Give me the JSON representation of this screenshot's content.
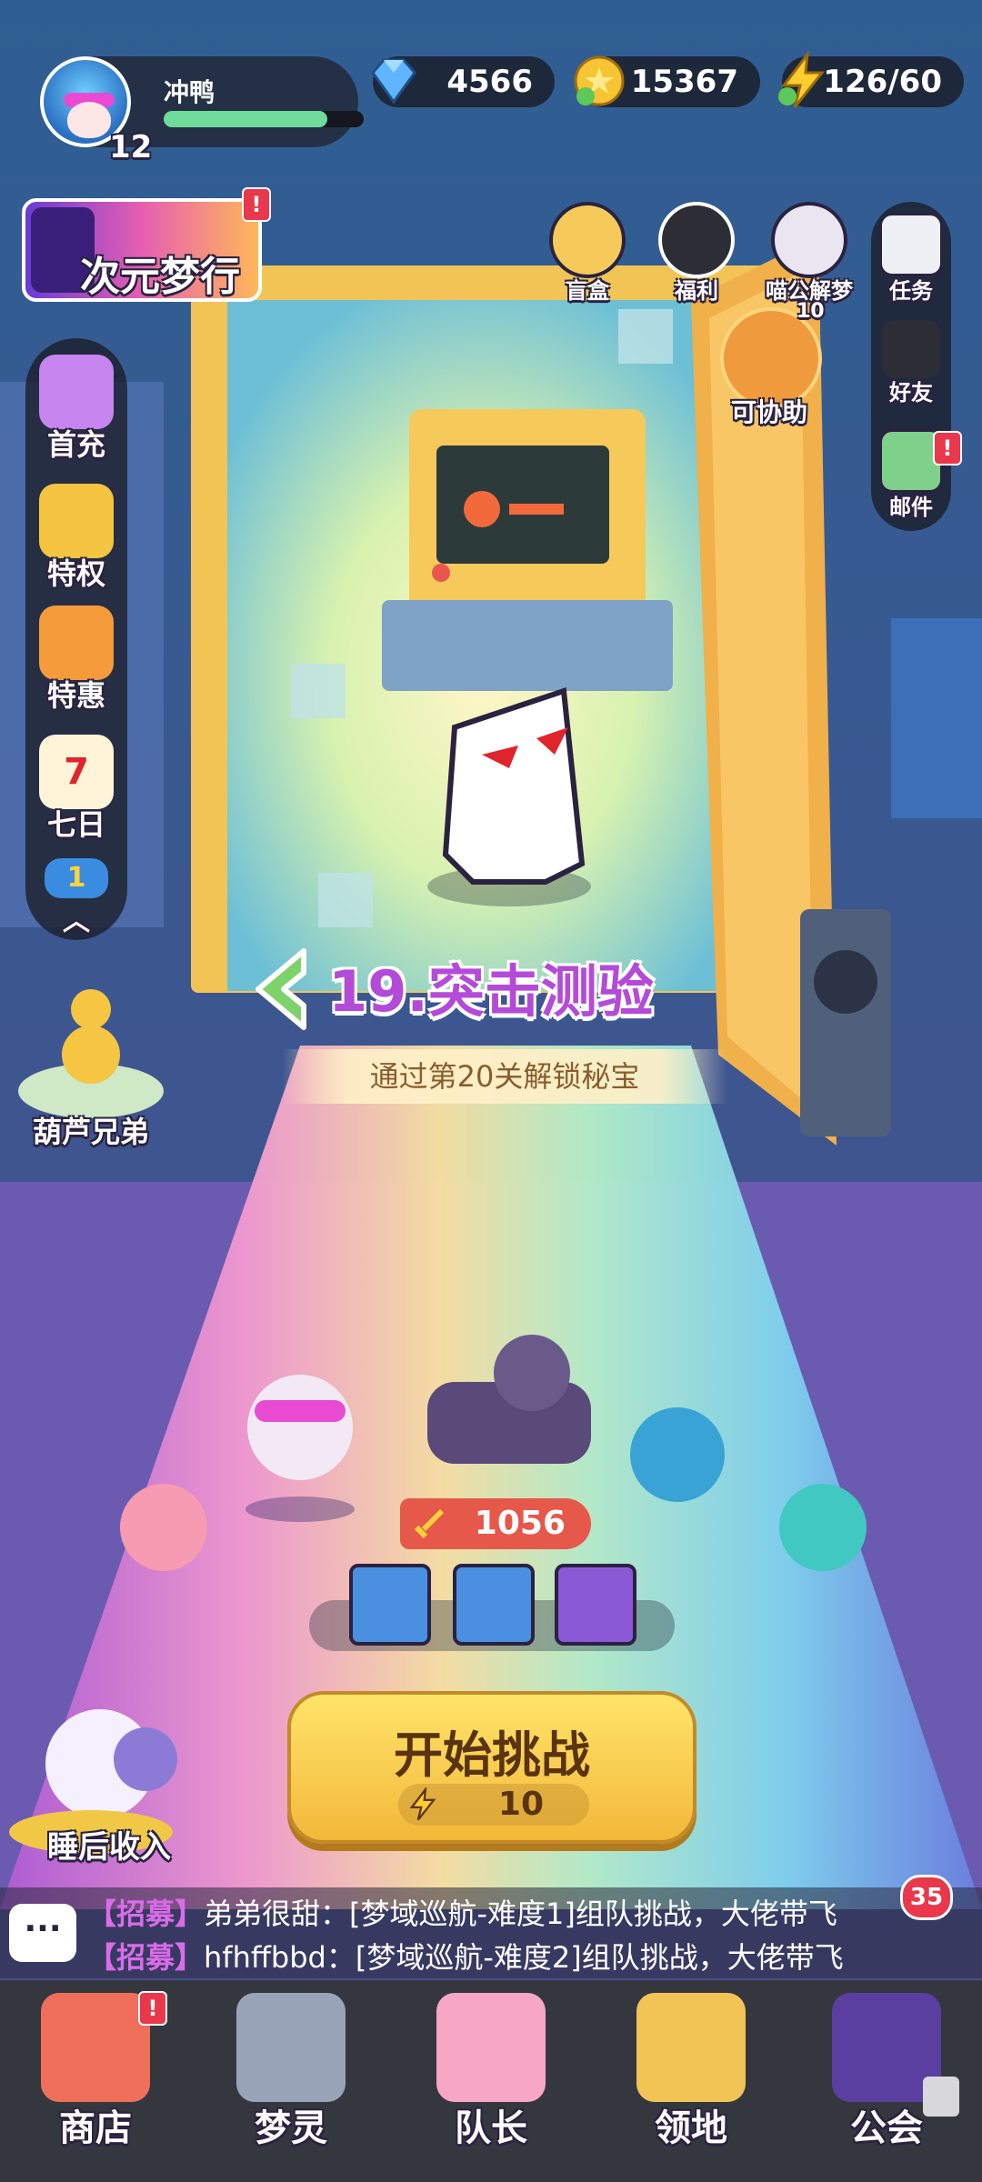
{
  "player": {
    "name": "冲鸭",
    "level": "12",
    "exp_fraction": 0.82
  },
  "resources": {
    "gems": "4566",
    "coins": "15367",
    "energy": "126/60"
  },
  "banner": {
    "label": "次元梦行"
  },
  "top_icons": {
    "blind_box": "盲盒",
    "welfare": "福利",
    "dream": "喵公解梦",
    "assist": "可协助",
    "assist_count": "10"
  },
  "right_menu": {
    "tasks": "任务",
    "friends": "好友",
    "mail": "邮件"
  },
  "left_menu": {
    "first_charge": "首充",
    "privilege": "特权",
    "deals": "特惠",
    "seven_days": "七日",
    "seven_num": "7",
    "more_num": "1"
  },
  "event": {
    "label": "葫芦兄弟"
  },
  "stage": {
    "title": "19.突击测验",
    "subtitle": "通过第20关解锁秘宝"
  },
  "team": {
    "power": "1056"
  },
  "start_button": {
    "label": "开始挑战",
    "cost": "10"
  },
  "idle": {
    "label": "睡后收入"
  },
  "chat": {
    "unread": "35",
    "lines": [
      {
        "tag": "【招募】",
        "text": "弟弟很甜：[梦域巡航-难度1]组队挑战，大佬带飞"
      },
      {
        "tag": "【招募】",
        "text": "hfhffbbd：[梦域巡航-难度2]组队挑战，大佬带飞"
      }
    ]
  },
  "nav": {
    "shop": "商店",
    "spirits": "梦灵",
    "captain": "队长",
    "territory": "领地",
    "guild": "公会"
  },
  "badge": "!",
  "colors": {
    "accent": "#f3b83a",
    "stage_title": "#b44bd8",
    "alert": "#e9384b"
  }
}
